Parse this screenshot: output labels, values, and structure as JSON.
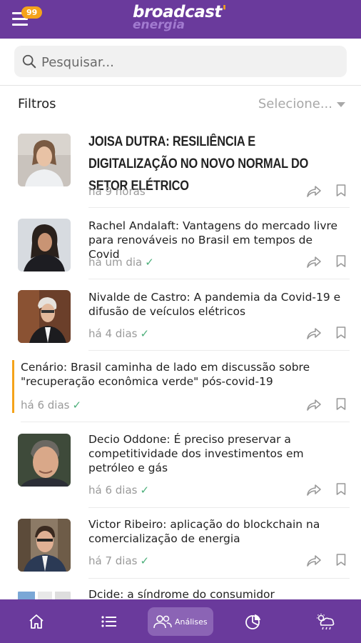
{
  "header": {
    "badge_count": "99",
    "logo_main": "broadcast",
    "logo_sub": "energia",
    "brand_color": "#6a3a9c",
    "accent_color": "#f5a31a"
  },
  "search": {
    "placeholder": "Pesquisar..."
  },
  "filters": {
    "label": "Filtros",
    "select_value": "Selecione..."
  },
  "articles": [
    {
      "title": "JOISA DUTRA: RESILIÊNCIA E DIGITALIZAÇÃO NO NOVO NORMAL DO SETOR ELÉTRICO",
      "time": "há 9 horas",
      "read": false
    },
    {
      "title": "Rachel Andalaft: Vantagens do mercado livre para renováveis no Brasil em tempos de Covid",
      "time": "há um dia",
      "read": true
    },
    {
      "title": "Nivalde de Castro: A pandemia da Covid-19 e difusão de veículos elétricos",
      "time": "há 4 dias",
      "read": true
    },
    {
      "title": "Cenário: Brasil caminha de lado em discussão sobre \"recuperação econômica verde\" pós-covid-19",
      "time": "há 6 dias",
      "read": true
    },
    {
      "title": "Decio Oddone: É preciso preservar a competitividade dos investimentos em petróleo e gás",
      "time": "há 6 dias",
      "read": true
    },
    {
      "title": "Victor Ribeiro: aplicação do blockchain na comercialização de energia",
      "time": "há 7 dias",
      "read": true
    },
    {
      "title": "Dcide: a síndrome do consumidor",
      "time": "",
      "read": false
    }
  ],
  "icons": {
    "check": "✓",
    "share": "share-icon",
    "bookmark": "bookmark-icon"
  },
  "bottom_nav": [
    {
      "icon": "home-icon"
    },
    {
      "icon": "list-icon"
    },
    {
      "icon": "analyses-icon",
      "label": "Análises",
      "active": true
    },
    {
      "icon": "pie-chart-icon"
    },
    {
      "icon": "weather-icon"
    }
  ]
}
